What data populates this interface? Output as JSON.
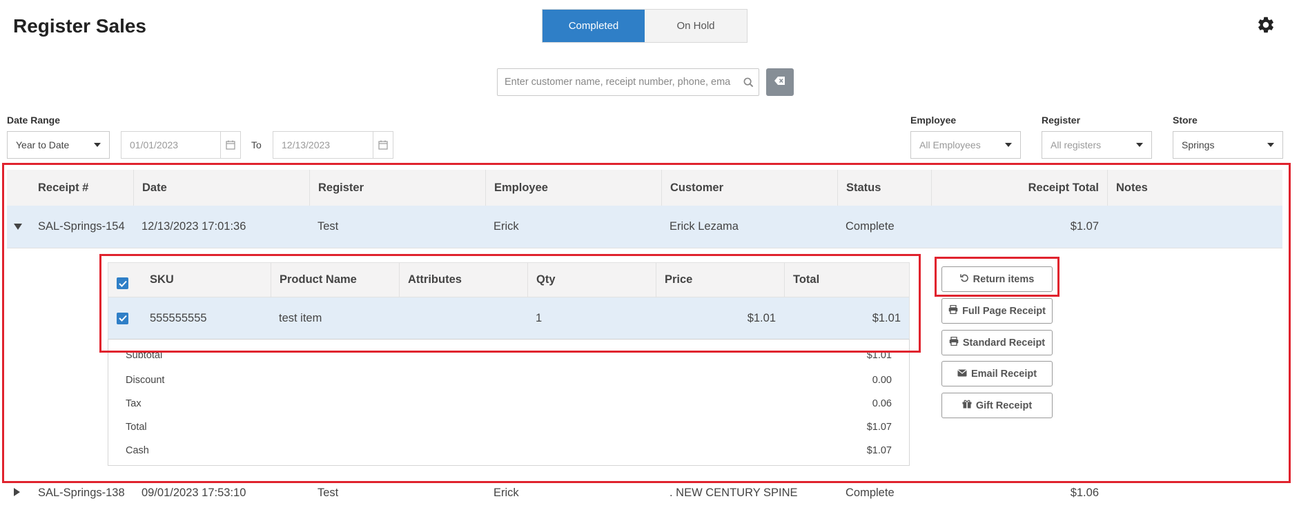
{
  "header": {
    "title": "Register Sales",
    "tabs": [
      {
        "label": "Completed",
        "active": true
      },
      {
        "label": "On Hold",
        "active": false
      }
    ],
    "settings_icon": "gear-icon"
  },
  "search": {
    "placeholder": "Enter customer name, receipt number, phone, email",
    "value": "",
    "icon": "search-icon",
    "clear_icon": "eraser-icon"
  },
  "filters": {
    "date_range": {
      "label": "Date Range",
      "value": "Year to Date"
    },
    "date_from": "01/01/2023",
    "to_label": "To",
    "date_to": "12/13/2023",
    "employee": {
      "label": "Employee",
      "value": "All Employees"
    },
    "register": {
      "label": "Register",
      "value": "All registers"
    },
    "store": {
      "label": "Store",
      "value": "Springs"
    }
  },
  "table": {
    "columns": [
      "Receipt #",
      "Date",
      "Register",
      "Employee",
      "Customer",
      "Status",
      "Receipt Total",
      "Notes"
    ],
    "rows": [
      {
        "receipt": "SAL-Springs-154",
        "date": "12/13/2023 17:01:36",
        "register": "Test",
        "employee": "Erick",
        "customer": "Erick Lezama",
        "status": "Complete",
        "total": "$1.07",
        "notes": "",
        "expanded": true
      },
      {
        "receipt": "SAL-Springs-138",
        "date": "09/01/2023 17:53:10",
        "register": "Test",
        "employee": "Erick",
        "customer": ". NEW CENTURY SPINE",
        "status": "Complete",
        "total": "$1.06",
        "notes": "",
        "expanded": false
      }
    ]
  },
  "detail": {
    "columns": [
      "SKU",
      "Product Name",
      "Attributes",
      "Qty",
      "Price",
      "Total"
    ],
    "items": [
      {
        "sku": "555555555",
        "name": "test item",
        "attributes": "",
        "qty": "1",
        "price": "$1.01",
        "total": "$1.01",
        "checked": true
      }
    ],
    "totals": [
      {
        "label": "Subtotal",
        "value": "$1.01"
      },
      {
        "label": "Discount",
        "value": "0.00"
      },
      {
        "label": "Tax",
        "value": "0.06"
      },
      {
        "label": "Total",
        "value": "$1.07"
      },
      {
        "label": "Cash",
        "value": "$1.07"
      }
    ]
  },
  "actions": [
    {
      "label": "Return items",
      "icon": "undo-icon"
    },
    {
      "label": "Full Page Receipt",
      "icon": "printer-icon"
    },
    {
      "label": "Standard Receipt",
      "icon": "printer-icon"
    },
    {
      "label": "Email Receipt",
      "icon": "envelope-icon"
    },
    {
      "label": "Gift Receipt",
      "icon": "gift-icon"
    }
  ],
  "colors": {
    "accent": "#2f7fc7",
    "highlight": "#e0232e",
    "selected_row": "#e3edf7"
  }
}
